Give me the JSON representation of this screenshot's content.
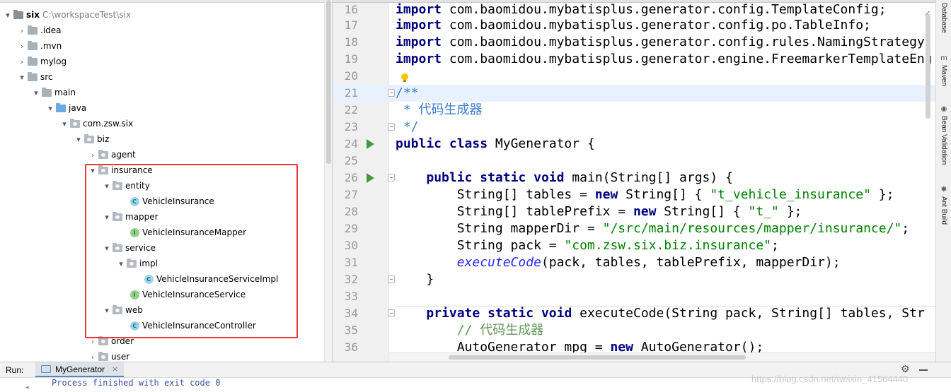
{
  "project_tree": {
    "root": {
      "name": "six",
      "path": "C:\\workspaceTest\\six"
    },
    "items": [
      {
        "label": ".idea",
        "icon": "folder-icon"
      },
      {
        "label": ".mvn",
        "icon": "folder-icon"
      },
      {
        "label": "mylog",
        "icon": "folder-icon"
      },
      {
        "label": "src",
        "icon": "folder-icon"
      },
      {
        "label": "main",
        "icon": "folder-icon"
      },
      {
        "label": "java",
        "icon": "source-folder-icon"
      },
      {
        "label": "com.zsw.six",
        "icon": "package-icon"
      },
      {
        "label": "biz",
        "icon": "package-icon"
      },
      {
        "label": "agent",
        "icon": "package-icon"
      },
      {
        "label": "insurance",
        "icon": "package-icon"
      },
      {
        "label": "entity",
        "icon": "package-icon"
      },
      {
        "label": "VehicleInsurance",
        "icon": "class-icon"
      },
      {
        "label": "mapper",
        "icon": "package-icon"
      },
      {
        "label": "VehicleInsuranceMapper",
        "icon": "interface-icon"
      },
      {
        "label": "service",
        "icon": "package-icon"
      },
      {
        "label": "impl",
        "icon": "package-icon"
      },
      {
        "label": "VehicleInsuranceServiceImpl",
        "icon": "class-icon"
      },
      {
        "label": "VehicleInsuranceService",
        "icon": "interface-icon"
      },
      {
        "label": "web",
        "icon": "package-icon"
      },
      {
        "label": "VehicleInsuranceController",
        "icon": "class-icon"
      },
      {
        "label": "order",
        "icon": "package-icon"
      },
      {
        "label": "user",
        "icon": "package-icon"
      }
    ],
    "class_badge": "C",
    "interface_badge": "I"
  },
  "editor": {
    "lines": [
      {
        "num": "16",
        "text": "import com.baomidou.mybatisplus.generator.config.TemplateConfig;"
      },
      {
        "num": "17",
        "text": "import com.baomidou.mybatisplus.generator.config.po.TableInfo;"
      },
      {
        "num": "18",
        "text": "import com.baomidou.mybatisplus.generator.config.rules.NamingStrategy"
      },
      {
        "num": "19",
        "text": "import com.baomidou.mybatisplus.generator.engine.FreemarkerTemplateEng"
      },
      {
        "num": "20",
        "text": ""
      },
      {
        "num": "21",
        "text": "/**"
      },
      {
        "num": "22",
        "text": " * 代码生成器"
      },
      {
        "num": "23",
        "text": " */"
      },
      {
        "num": "24",
        "text": "public class MyGenerator {"
      },
      {
        "num": "25",
        "text": ""
      },
      {
        "num": "26",
        "text": "    public static void main(String[] args) {"
      },
      {
        "num": "27",
        "text": "        String[] tables = new String[] { \"t_vehicle_insurance\" };"
      },
      {
        "num": "28",
        "text": "        String[] tablePrefix = new String[] { \"t_\" };"
      },
      {
        "num": "29",
        "text": "        String mapperDir = \"/src/main/resources/mapper/insurance/\";"
      },
      {
        "num": "30",
        "text": "        String pack = \"com.zsw.six.biz.insurance\";"
      },
      {
        "num": "31",
        "text": "        executeCode(pack, tables, tablePrefix, mapperDir);"
      },
      {
        "num": "32",
        "text": "    }"
      },
      {
        "num": "33",
        "text": ""
      },
      {
        "num": "34",
        "text": "    private static void executeCode(String pack, String[] tables, Str"
      },
      {
        "num": "35",
        "text": "        // 代码生成器"
      },
      {
        "num": "36",
        "text": "        AutoGenerator mpg = new AutoGenerator();"
      }
    ]
  },
  "right_tools": [
    {
      "label": "Database",
      "icon": "database-icon"
    },
    {
      "label": "Maven",
      "icon": "maven-icon"
    },
    {
      "label": "Bean Validation",
      "icon": "bean-validation-icon"
    },
    {
      "label": "Ant Build",
      "icon": "ant-icon"
    }
  ],
  "run_panel": {
    "label": "Run:",
    "tab_label": "MyGenerator",
    "close_glyph": "×",
    "console_text": "Process finished with exit code 0"
  },
  "watermark": "https://blog.csdn.net/weixin_41564440"
}
